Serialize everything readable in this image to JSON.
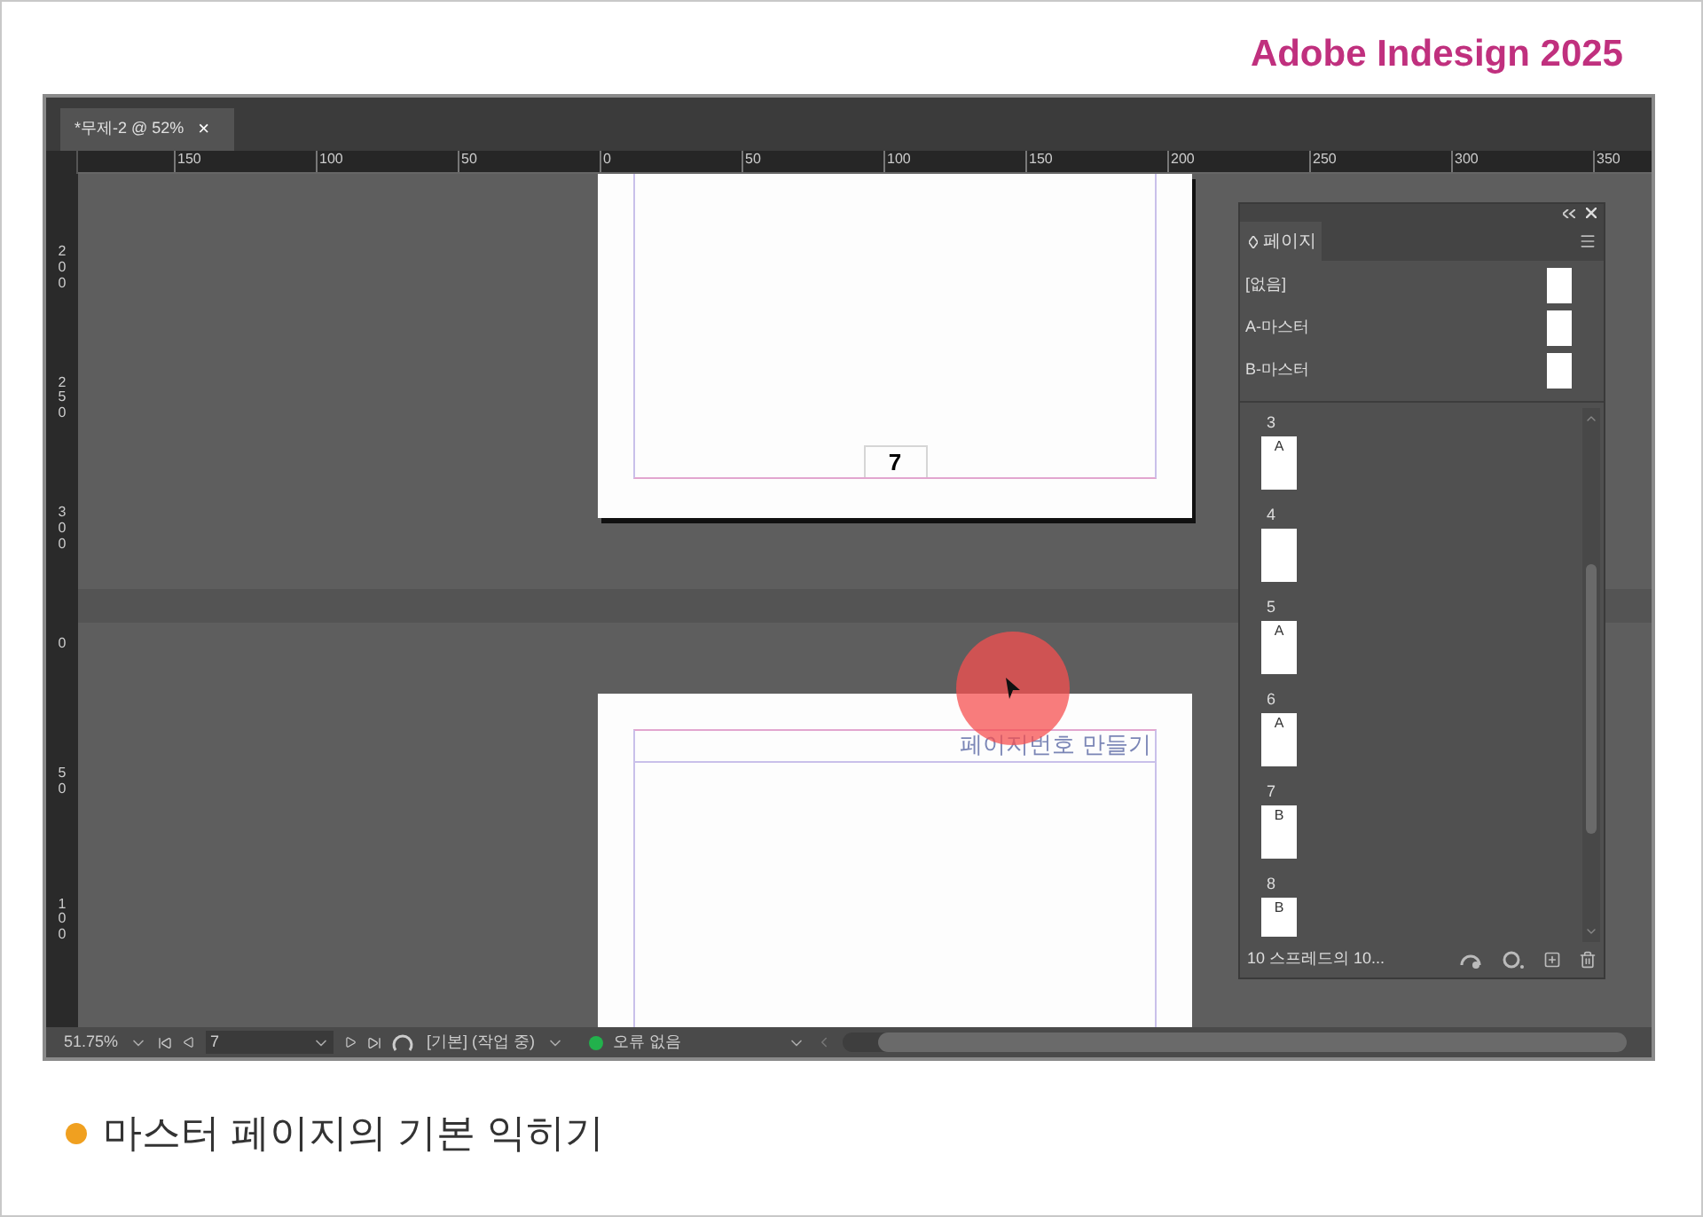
{
  "header": {
    "title": "Adobe Indesign 2025"
  },
  "document_tab": {
    "label": "*무제-2 @ 52%",
    "close": "×",
    "selected": true
  },
  "horizontal_ruler": {
    "labels": [
      "150",
      "100",
      "50",
      "0",
      "50",
      "100",
      "150",
      "200",
      "250",
      "300",
      "350"
    ]
  },
  "vertical_ruler": {
    "labels": [
      "200",
      "250",
      "300",
      "0",
      "50",
      "100"
    ]
  },
  "pages": [
    {
      "kind": "number_footer",
      "text": "7"
    },
    {
      "kind": "running_header",
      "text": "페이지번호 만들기"
    }
  ],
  "pages_panel": {
    "title": "페이지",
    "masters": [
      "[없음]",
      "A-마스터",
      "B-마스터"
    ],
    "pages": [
      {
        "number": "3",
        "master": "A"
      },
      {
        "number": "4"
      },
      {
        "number": "5",
        "master": "A"
      },
      {
        "number": "6",
        "master": "A"
      },
      {
        "number": "7",
        "master": "B"
      },
      {
        "number": "8",
        "master": "B"
      }
    ],
    "summary": "10 스프레드의 10..."
  },
  "status_bar": {
    "zoom": "51.75%",
    "page": "7",
    "profile": "[기본] (작업 중)",
    "errors": "오류 없음"
  },
  "caption": {
    "text": "마스터 페이지의 기본 익히기"
  }
}
